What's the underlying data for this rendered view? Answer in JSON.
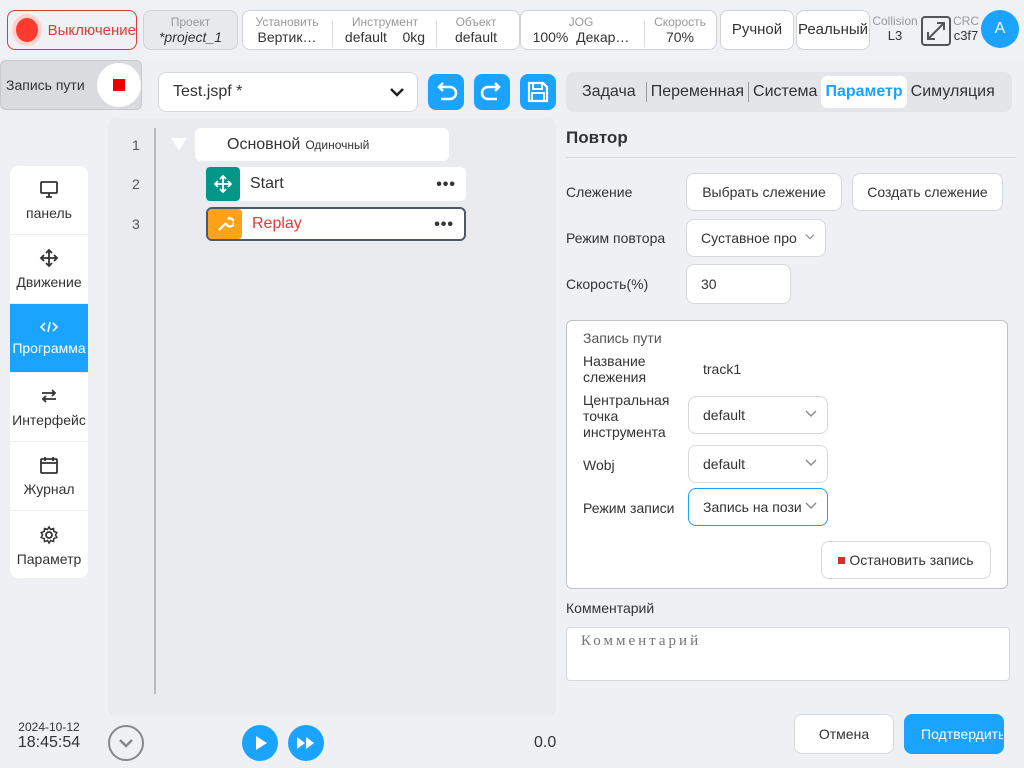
{
  "topbar": {
    "power_label": "Выключение",
    "project": {
      "label": "Проект",
      "value": "*project_1"
    },
    "install": {
      "label": "Установить",
      "value": "Вертик…"
    },
    "tool": {
      "label": "Инструмент",
      "value1": "default",
      "value2": "0kg"
    },
    "object": {
      "label": "Объект",
      "value": "default"
    },
    "jog": {
      "label": "JOG",
      "value1": "100%",
      "value2": "Декар…"
    },
    "speed": {
      "label": "Скорость",
      "value": "70%"
    },
    "manual": "Ручной",
    "real": "Реальный",
    "collision": {
      "label": "Collision",
      "value": "L3"
    },
    "crc": {
      "label": "CRC",
      "value": "c3f7"
    },
    "avatar": "A"
  },
  "record_path_label": "Запись пути",
  "file": {
    "name": "Test.jspf *"
  },
  "nav": {
    "items": [
      {
        "label": "панель"
      },
      {
        "label": "Движение"
      },
      {
        "label": "Программа"
      },
      {
        "label": "Интерфейс"
      },
      {
        "label": "Журнал"
      },
      {
        "label": "Параметр"
      }
    ]
  },
  "program": {
    "lines": [
      "1",
      "2",
      "3"
    ],
    "root": {
      "label": "Основной",
      "sub": "Одиночный"
    },
    "start": "Start",
    "replay": "Replay",
    "time": "0.0"
  },
  "datetime": {
    "date": "2024-10-12",
    "time": "18:45:54"
  },
  "tabs": [
    "Задача",
    "Переменная",
    "Система",
    "Параметр",
    "Симуляция"
  ],
  "panel": {
    "title": "Повтор",
    "tracking_label": "Слежение",
    "select_tracking": "Выбрать слежение",
    "create_tracking": "Создать слежение",
    "replay_mode_label": "Режим повтора",
    "replay_mode_value": "Суставное про",
    "speed_label": "Скорость(%)",
    "speed_value": "30",
    "group": {
      "title": "Запись пути",
      "name_label1": "Название",
      "name_label2": "слежения",
      "name_value": "track1",
      "tcp_label1": "Центральная",
      "tcp_label2": "точка",
      "tcp_label3": "инструмента",
      "tcp_value": "default",
      "wobj_label": "Wobj",
      "wobj_value": "default",
      "rec_mode_label": "Режим записи",
      "rec_mode_value": "Запись на пози",
      "stop_record": "Остановить запись"
    },
    "comment_label": "Комментарий",
    "comment_placeholder": "Комментарий",
    "cancel": "Отмена",
    "confirm": "Подтвердить"
  },
  "colors": {
    "accent": "#1aa3ff",
    "danger": "#e53935",
    "teal": "#009688",
    "orange": "#ffa21a"
  }
}
